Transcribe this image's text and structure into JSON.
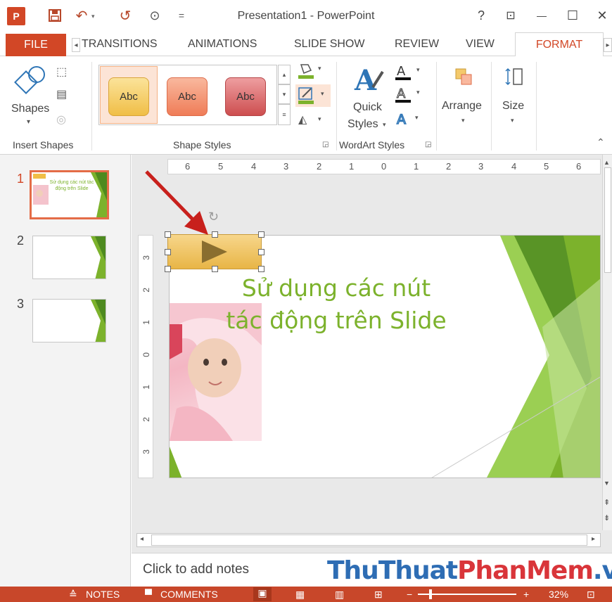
{
  "window": {
    "title": "Presentation1 - PowerPoint",
    "help": "?",
    "ribbon_display": "⊡",
    "minimize": "—",
    "maximize": "☐",
    "close": "✕"
  },
  "quick_access": {
    "app_icon": "P",
    "save": "💾",
    "undo": "↶",
    "redo": "↺",
    "start_from_beginning": "⊙",
    "customize": "="
  },
  "tabs": {
    "file": "FILE",
    "scroll_left": "◂",
    "items": [
      "TRANSITIONS",
      "ANIMATIONS",
      "SLIDE SHOW",
      "REVIEW",
      "VIEW"
    ],
    "active": "FORMAT",
    "scroll_right": "▸"
  },
  "ribbon": {
    "insert_shapes": {
      "shapes_label": "Shapes",
      "group_label": "Insert Shapes"
    },
    "shape_styles": {
      "gallery": [
        "Abc",
        "Abc",
        "Abc"
      ],
      "group_label": "Shape Styles"
    },
    "wordart_styles": {
      "quick_styles_line1": "Quick",
      "quick_styles_line2": "Styles",
      "group_label": "WordArt Styles"
    },
    "arrange": {
      "label": "Arrange"
    },
    "size": {
      "label": "Size"
    },
    "collapse": "⌃"
  },
  "slides_pane": {
    "slides": [
      {
        "number": "1",
        "title": "Sử dụng các nút tác động trên Slide"
      },
      {
        "number": "2"
      },
      {
        "number": "3"
      }
    ]
  },
  "ruler": {
    "horizontal": [
      "6",
      "5",
      "4",
      "3",
      "2",
      "1",
      "0",
      "1",
      "2",
      "3",
      "4",
      "5",
      "6"
    ],
    "vertical": [
      "3",
      "2",
      "1",
      "0",
      "1",
      "2",
      "3"
    ]
  },
  "slide": {
    "title": "Sử dụng các nút tác động trên Slide"
  },
  "notes": {
    "placeholder": "Click to add notes",
    "watermark_part1": "ThuThuat",
    "watermark_part2": "PhanMem",
    "watermark_part3": ".vn"
  },
  "status": {
    "notes": "NOTES",
    "comments": "COMMENTS",
    "zoom": "32%"
  },
  "colors": {
    "accent": "#d24726",
    "slide_title": "#7cb22c",
    "status_bar": "#c8472a"
  }
}
